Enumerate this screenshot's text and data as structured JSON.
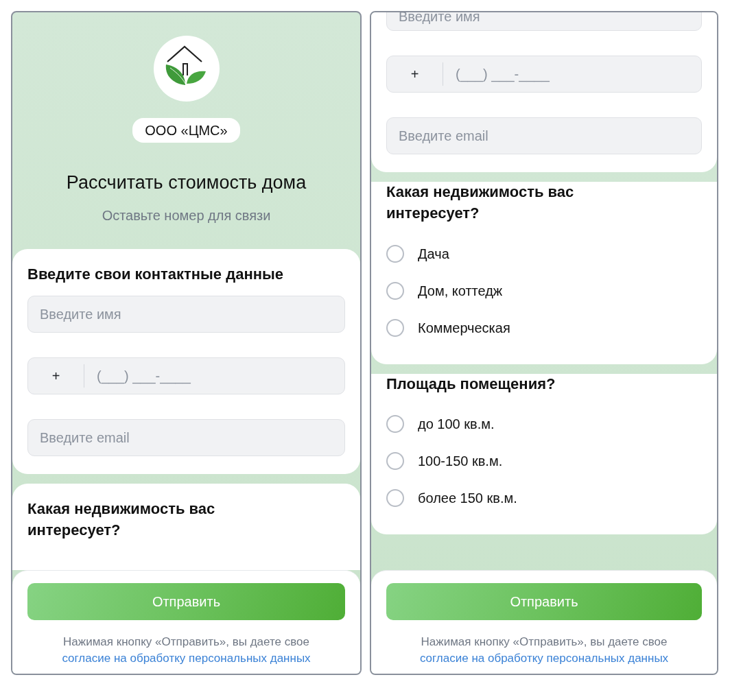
{
  "screens": [
    {
      "company": "ООО «ЦМС»",
      "title": "Рассчитать стоимость дома",
      "subtitle": "Оставьте номер для связи",
      "cards": [
        {
          "kind": "contacts",
          "title": "Введите свои контактные данные",
          "fields": [
            {
              "kind": "text",
              "placeholder": "Введите имя"
            },
            {
              "kind": "phone",
              "prefix": "+",
              "placeholder": "(___) ___-____"
            },
            {
              "kind": "text",
              "placeholder": "Введите email"
            }
          ]
        },
        {
          "kind": "question",
          "title": "Какая недвижимость вас интересует?"
        }
      ],
      "footer": {
        "button": "Отправить",
        "note": "Нажимая кнопку «Отправить», вы даете свое",
        "link": "согласие на обработку персональных данных"
      }
    },
    {
      "cards": [
        {
          "kind": "contacts",
          "fields": [
            {
              "kind": "text",
              "placeholder": "Введите имя"
            },
            {
              "kind": "phone",
              "prefix": "+",
              "placeholder": "(___) ___-____"
            },
            {
              "kind": "text",
              "placeholder": "Введите email"
            }
          ]
        },
        {
          "kind": "question",
          "title": "Какая недвижимость вас интересует?",
          "options": [
            {
              "label": "Дача",
              "selected": false
            },
            {
              "label": "Дом, коттедж",
              "selected": false
            },
            {
              "label": "Коммерческая",
              "selected": false
            }
          ]
        },
        {
          "kind": "question",
          "title": "Площадь помещения?",
          "options": [
            {
              "label": "до 100 кв.м.",
              "selected": false
            },
            {
              "label": "100-150 кв.м.",
              "selected": false
            },
            {
              "label": "более 150 кв.м.",
              "selected": false
            }
          ]
        }
      ],
      "footer": {
        "button": "Отправить",
        "note": "Нажимая кнопку «Отправить», вы даете свое",
        "link": "согласие на обработку персональных данных"
      }
    }
  ]
}
